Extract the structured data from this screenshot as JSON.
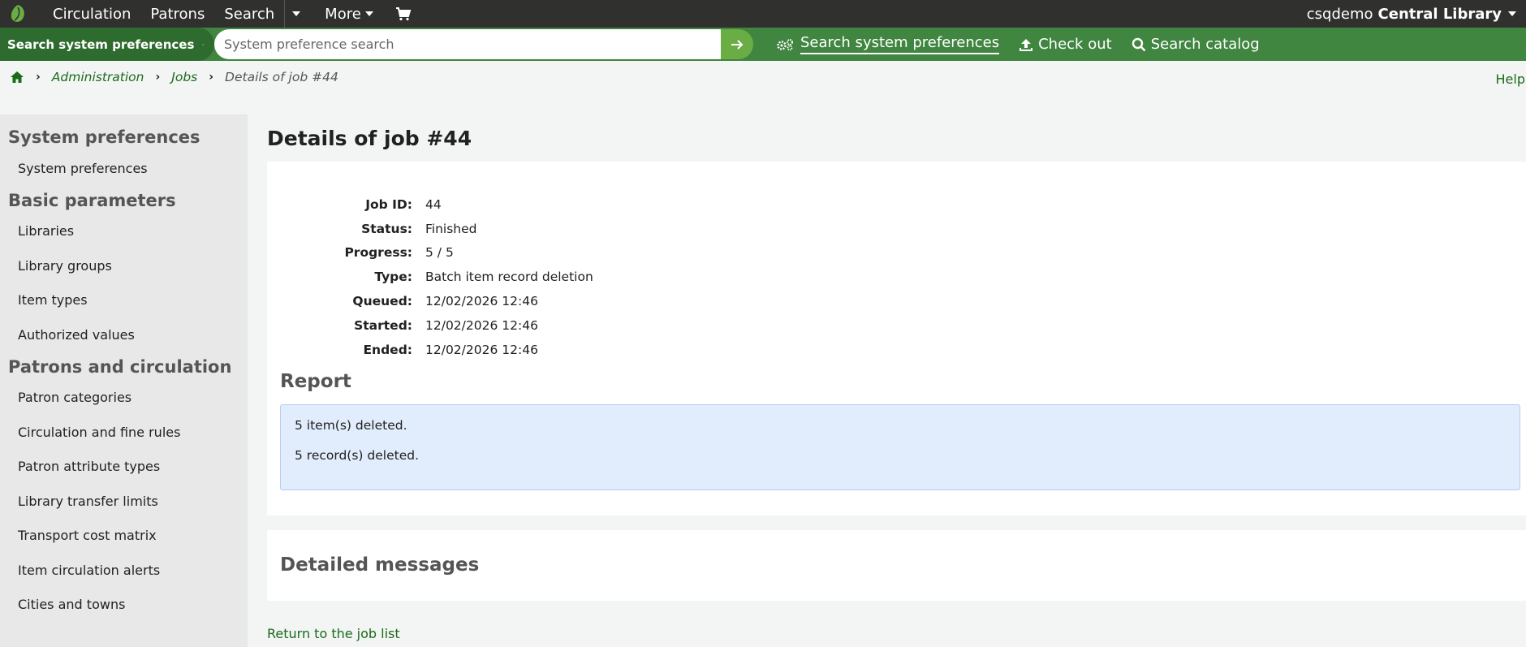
{
  "topnav": {
    "items": [
      "Circulation",
      "Patrons",
      "Search",
      "More"
    ],
    "user": "csqdemo",
    "library": "Central Library"
  },
  "searchbar": {
    "label": "Search system preferences",
    "placeholder": "System preference search",
    "tabs": [
      "Search system preferences",
      "Check out",
      "Search catalog"
    ]
  },
  "breadcrumb": {
    "items": [
      "Administration",
      "Jobs"
    ],
    "current": "Details of job #44"
  },
  "help_label": "Help",
  "sidebar": {
    "sections": [
      {
        "heading": "System preferences",
        "links": [
          "System preferences"
        ]
      },
      {
        "heading": "Basic parameters",
        "links": [
          "Libraries",
          "Library groups",
          "Item types",
          "Authorized values"
        ]
      },
      {
        "heading": "Patrons and circulation",
        "links": [
          "Patron categories",
          "Circulation and fine rules",
          "Patron attribute types",
          "Library transfer limits",
          "Transport cost matrix",
          "Item circulation alerts",
          "Cities and towns"
        ]
      }
    ]
  },
  "main": {
    "title": "Details of job #44",
    "fields": [
      {
        "label": "Job ID:",
        "value": "44"
      },
      {
        "label": "Status:",
        "value": "Finished"
      },
      {
        "label": "Progress:",
        "value": "5 / 5"
      },
      {
        "label": "Type:",
        "value": "Batch item record deletion"
      },
      {
        "label": "Queued:",
        "value": "12/02/2026 12:46"
      },
      {
        "label": "Started:",
        "value": "12/02/2026 12:46"
      },
      {
        "label": "Ended:",
        "value": "12/02/2026 12:46"
      }
    ],
    "report_title": "Report",
    "report_lines": [
      "5 item(s) deleted.",
      "5 record(s) deleted."
    ],
    "detailed_title": "Detailed messages",
    "return_link": "Return to the job list"
  },
  "colors": {
    "topnav_bg": "#30302f",
    "searchbar_bg": "#408540",
    "link": "#1a6b1a",
    "report_bg": "#e1ecfc"
  }
}
